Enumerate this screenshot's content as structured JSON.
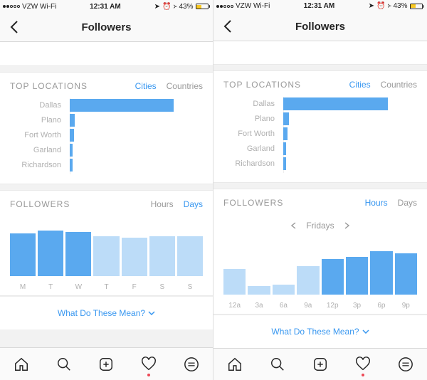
{
  "left": {
    "status": {
      "carrier": "VZW Wi-Fi",
      "time": "12:31 AM",
      "battery_pct": "43%"
    },
    "nav": {
      "title": "Followers"
    },
    "locations": {
      "title": "TOP LOCATIONS",
      "tab_cities": "Cities",
      "tab_countries": "Countries",
      "active_tab": "cities"
    },
    "followers": {
      "title": "FOLLOWERS",
      "tab_hours": "Hours",
      "tab_days": "Days",
      "active_tab": "days"
    },
    "meaning": "What Do These Mean?"
  },
  "right": {
    "status": {
      "carrier": "VZW Wi-Fi",
      "time": "12:31 AM",
      "battery_pct": "43%"
    },
    "nav": {
      "title": "Followers"
    },
    "locations": {
      "title": "TOP LOCATIONS",
      "tab_cities": "Cities",
      "tab_countries": "Countries",
      "active_tab": "cities"
    },
    "followers": {
      "title": "FOLLOWERS",
      "tab_hours": "Hours",
      "tab_days": "Days",
      "active_tab": "hours",
      "day_picker": "Fridays"
    },
    "meaning": "What Do These Mean?"
  },
  "chart_data": [
    {
      "type": "bar",
      "orientation": "horizontal",
      "screen": "left",
      "title": "TOP LOCATIONS",
      "categories": [
        "Dallas",
        "Plano",
        "Fort Worth",
        "Garland",
        "Richardson"
      ],
      "values": [
        78,
        4,
        3,
        2,
        2
      ],
      "xlim": [
        0,
        100
      ],
      "note": "values are relative percentages estimated from bar lengths"
    },
    {
      "type": "bar",
      "screen": "left",
      "title": "FOLLOWERS",
      "categories": [
        "M",
        "T",
        "W",
        "T",
        "F",
        "S",
        "S"
      ],
      "values": [
        75,
        80,
        78,
        70,
        68,
        70,
        70
      ],
      "highlight_indices": [
        0,
        1,
        2
      ],
      "ylim": [
        0,
        100
      ]
    },
    {
      "type": "bar",
      "orientation": "horizontal",
      "screen": "right",
      "title": "TOP LOCATIONS",
      "categories": [
        "Dallas",
        "Plano",
        "Fort Worth",
        "Garland",
        "Richardson"
      ],
      "values": [
        78,
        4,
        3,
        2,
        2
      ],
      "xlim": [
        0,
        100
      ]
    },
    {
      "type": "bar",
      "screen": "right",
      "title": "FOLLOWERS",
      "subtitle": "Fridays",
      "categories": [
        "12a",
        "3a",
        "6a",
        "9a",
        "12p",
        "3p",
        "6p",
        "9p"
      ],
      "values": [
        45,
        15,
        18,
        50,
        62,
        66,
        76,
        72
      ],
      "highlight_indices": [
        4,
        5,
        6,
        7
      ],
      "ylim": [
        0,
        100
      ]
    }
  ]
}
